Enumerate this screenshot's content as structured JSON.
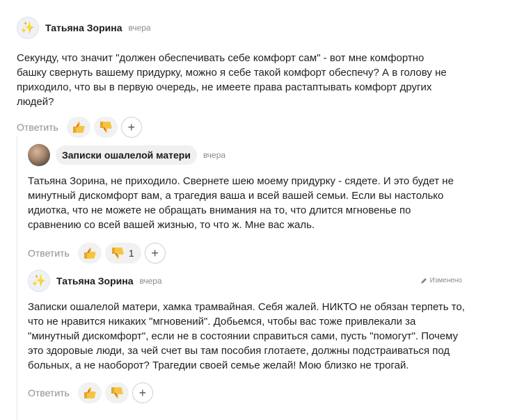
{
  "comments": [
    {
      "author": "Татьяна Зорина",
      "time": "вчера",
      "text": "Секунду, что значит \"должен обеспечивать себе комфорт сам\" - вот мне комфортно башку свернуть вашему придурку, можно я себе такой комфорт обеспечу? А в голову не приходило, что вы в первую очередь, не имеете права растаптывать комфорт других людей?",
      "reply_label": "Ответить",
      "dislike_count": ""
    },
    {
      "author": "Записки ошалелой матери",
      "time": "вчера",
      "text": "Татьяна Зорина, не приходило. Свернете шею моему придурку - сядете. И это будет не минутный дискомфорт вам, а трагедия ваша и всей вашей семьи. Если вы настолько идиотка, что не можете не обращать внимания на то, что длится мгновенье по сравнению со всей вашей жизнью, то что ж. Мне вас жаль.",
      "reply_label": "Ответить",
      "dislike_count": "1"
    },
    {
      "author": "Татьяна Зорина",
      "time": "вчера",
      "edited_label": "Изменено",
      "text": "Записки ошалелой матери, хамка трамвайная. Себя жалей. НИКТО не обязан терпеть то, что не нравится никаких \"мгновений\". Добьемся, чтобы вас тоже привлекали за \"минутный дискомфорт\", если не в состоянии справиться сами, пусть \"помогут\". Почему это здоровые люди, за чей счет вы там пособия глотаете, должны подстраиваться под больных, а не наоборот? Трагедии своей семье желай! Мою близко не трогай.",
      "reply_label": "Ответить",
      "dislike_count": ""
    }
  ],
  "icons": {
    "avatar_sparkle": "✨",
    "plus": "+"
  },
  "colors": {
    "reaction_yellow": "#f5c542",
    "reaction_bg": "#f1f1f1",
    "muted_text": "#8f8f8f"
  }
}
